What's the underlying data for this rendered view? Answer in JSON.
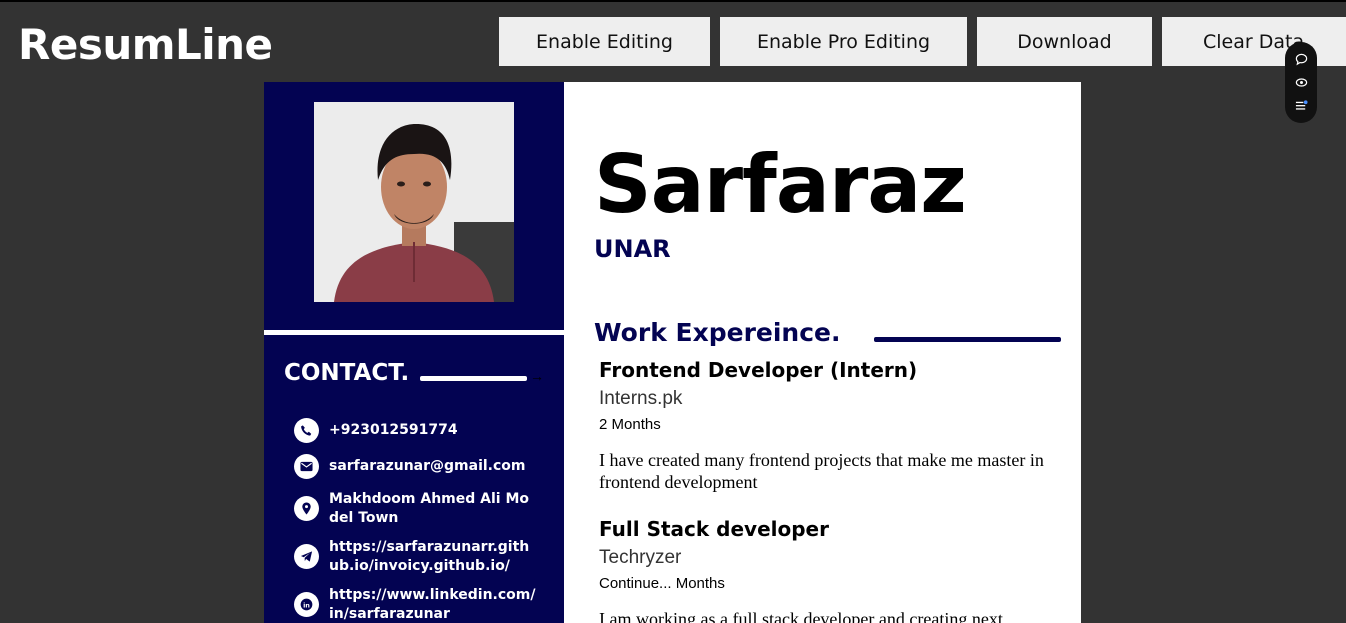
{
  "app": {
    "logo": "ResumLine"
  },
  "toolbar": {
    "enable_editing": "Enable Editing",
    "enable_pro_editing": "Enable Pro Editing",
    "download": "Download",
    "clear_data": "Clear Data"
  },
  "floating_toolbar": {
    "icons": [
      "chat-bubble-icon",
      "eye-icon",
      "list-settings-icon"
    ]
  },
  "resume": {
    "first_name": "Sarfaraz",
    "last_name": "UNAR",
    "contact": {
      "title": "CONTACT.",
      "items": [
        {
          "icon": "phone-icon",
          "text": "+923012591774"
        },
        {
          "icon": "email-icon",
          "text": "sarfarazunar@gmail.com"
        },
        {
          "icon": "location-icon",
          "text": "Makhdoom Ahmed Ali Model Town"
        },
        {
          "icon": "telegram-icon",
          "text": "https://sarfarazunarr.github.io/invoicy.github.io/"
        },
        {
          "icon": "linkedin-icon",
          "text": "https://www.linkedin.com/in/sarfarazunar"
        }
      ]
    },
    "work": {
      "title": "Work Expereince.",
      "jobs": [
        {
          "title": "Frontend Developer (Intern)",
          "company": "Interns.pk",
          "duration": "2 Months",
          "description": "I have created many frontend projects that make me master in frontend development"
        },
        {
          "title": "Full Stack developer",
          "company": "Techryzer",
          "duration": "Continue... Months",
          "description": "I am working as a full stack developer and creating next"
        }
      ]
    }
  },
  "colors": {
    "sidebar": "#030352",
    "background": "#333333",
    "accent": "#030352"
  }
}
